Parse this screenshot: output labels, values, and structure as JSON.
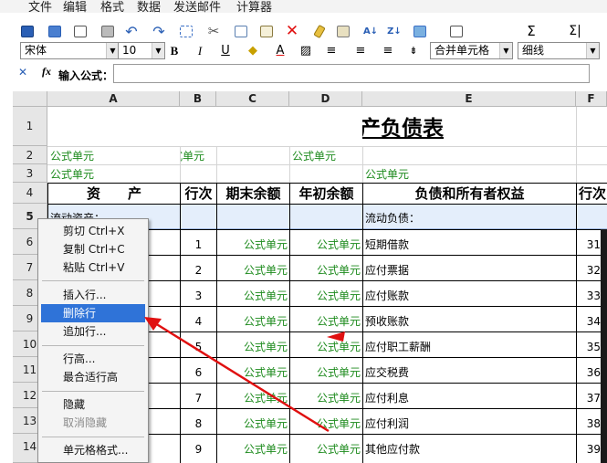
{
  "menubar": {
    "items": [
      "文件",
      "编辑",
      "格式",
      "数据",
      "发送邮件",
      "计算器"
    ]
  },
  "toolbar": {
    "icons": [
      "save-icon",
      "save-as-icon",
      "print-preview-icon",
      "print-icon",
      "undo-icon",
      "redo-icon",
      "grid-icon",
      "cut-icon",
      "copy-icon",
      "paste-icon",
      "delete-icon",
      "clear-icon",
      "edit-icon",
      "sort-asc-icon",
      "sort-desc-icon",
      "picture-icon",
      "insert-icon",
      "sum-icon",
      "sum-all-icon"
    ],
    "sigma": "Σ",
    "sigma_all": "Σ|",
    "sort_asc": "A↓",
    "sort_desc": "Z↓",
    "x_mark": "✕"
  },
  "format": {
    "font": "宋体",
    "size": "10",
    "bold": "B",
    "italic": "I",
    "underline": "U",
    "font_color": "A",
    "merge": "合并单元格",
    "border": "细线"
  },
  "formula": {
    "label": "输入公式：",
    "fx": "fx",
    "value": ""
  },
  "columns": [
    "A",
    "B",
    "C",
    "D",
    "E",
    "F"
  ],
  "rows": [
    "1",
    "2",
    "3",
    "4",
    "5",
    "6",
    "7",
    "8",
    "9",
    "10",
    "11",
    "12",
    "13",
    "14"
  ],
  "sheet": {
    "title": "资产负债表",
    "r2": {
      "a": "公式单元",
      "b": "式单元",
      "d": "公式单元"
    },
    "r3": {
      "a": "公式单元",
      "e": "公式单元"
    },
    "headers": {
      "a": "资　　产",
      "b": "行次",
      "c": "期末余额",
      "d": "年初余额",
      "e": "负债和所有者权益",
      "f": "行次"
    },
    "r5": {
      "a": "流动资产：",
      "e": "流动负债："
    },
    "data": [
      {
        "b": "1",
        "c": "公式单元",
        "d": "公式单元",
        "e": "短期借款",
        "f": "31"
      },
      {
        "b": "2",
        "c": "公式单元",
        "d": "公式单元",
        "e": "应付票据",
        "f": "32"
      },
      {
        "b": "3",
        "c": "公式单元",
        "d": "公式单元",
        "e": "应付账款",
        "f": "33"
      },
      {
        "b": "4",
        "c": "公式单元",
        "d": "公式单元",
        "e": "预收账款",
        "f": "34"
      },
      {
        "b": "5",
        "c": "公式单元",
        "d": "公式单元",
        "e": "应付职工薪酬",
        "f": "35"
      },
      {
        "b": "6",
        "c": "公式单元",
        "d": "公式单元",
        "e": "应交税费",
        "f": "36"
      },
      {
        "b": "7",
        "c": "公式单元",
        "d": "公式单元",
        "e": "应付利息",
        "f": "37"
      },
      {
        "b": "8",
        "c": "公式单元",
        "d": "公式单元",
        "e": "应付利润",
        "f": "38"
      },
      {
        "b": "9",
        "c": "公式单元",
        "d": "公式单元",
        "e": "其他应付款",
        "f": "39"
      }
    ]
  },
  "context_menu": {
    "cut": "剪切  Ctrl+X",
    "copy": "复制  Ctrl+C",
    "paste": "粘贴  Ctrl+V",
    "insert_row": "插入行...",
    "delete_row": "删除行",
    "append_row": "追加行...",
    "row_height": "行高...",
    "best_fit_row_height": "最合适行高",
    "hide": "隐藏",
    "unhide": "取消隐藏",
    "cell_format": "单元格格式..."
  },
  "colors": {
    "accent": "#2f73d8",
    "formula_green": "#1c8a1c",
    "arrow_red": "#e01010",
    "header_bg": "#e6e6e6"
  }
}
